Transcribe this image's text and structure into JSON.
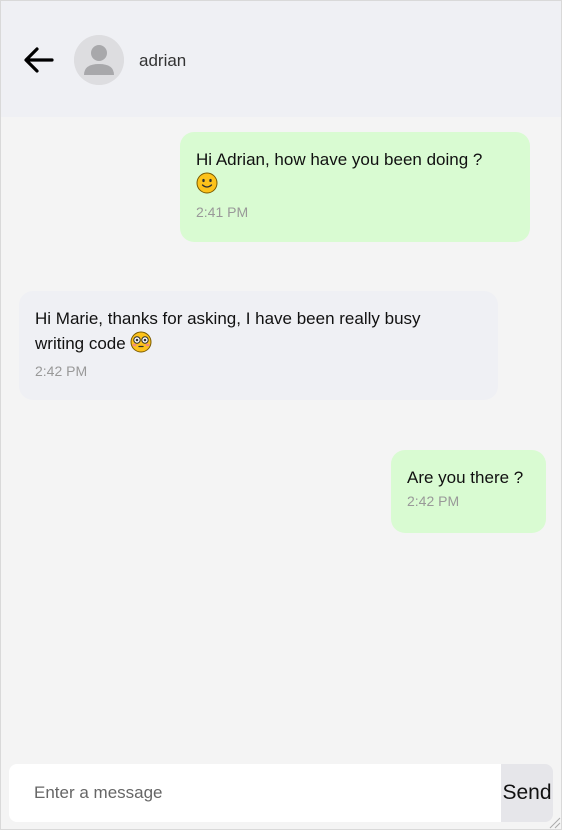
{
  "header": {
    "back_icon": "arrow-left-icon",
    "avatar_icon": "user-avatar-icon",
    "contact_name": "adrian"
  },
  "messages": [
    {
      "direction": "sent",
      "text_parts": [
        "Hi Adrian, how have you been doing ?"
      ],
      "emoji_icon": "slightly-smiling-face-emoji",
      "time": "2:41 PM"
    },
    {
      "direction": "received",
      "text_parts": [
        "Hi Marie, thanks for asking, I have been really busy",
        "writing code"
      ],
      "emoji_icon": "flushed-face-emoji",
      "time": "2:42 PM"
    },
    {
      "direction": "sent",
      "text_parts": [
        "Are you there ?"
      ],
      "emoji_icon": "",
      "time": "2:42 PM"
    }
  ],
  "composer": {
    "placeholder": "Enter a message",
    "send_label": "Send"
  },
  "colors": {
    "sent_bubble": "#d9fbd2",
    "received_bubble": "#eff0f4",
    "header_background": "#eff0f4",
    "chat_background": "#f4f4f4"
  }
}
